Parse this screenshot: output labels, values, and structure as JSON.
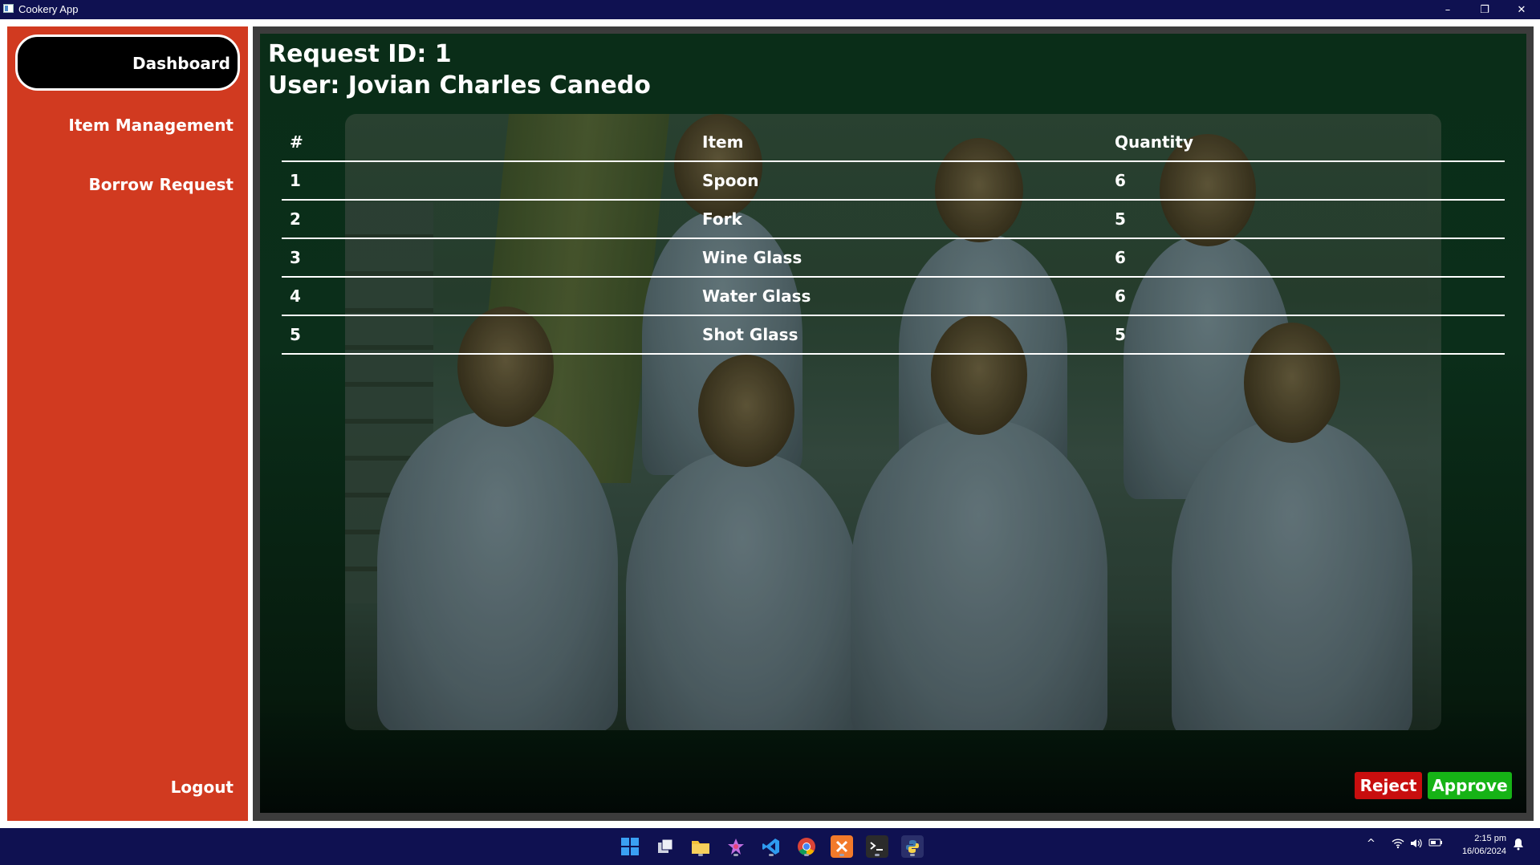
{
  "window": {
    "title": "Cookery App",
    "controls": {
      "minimize": "–",
      "restore": "❐",
      "close": "✕"
    }
  },
  "sidebar": {
    "items": [
      {
        "label": "Dashboard",
        "active": true
      },
      {
        "label": "Item Management"
      },
      {
        "label": "Borrow Request"
      }
    ],
    "logout_label": "Logout"
  },
  "request": {
    "id_label": "Request ID: 1",
    "user_label": "User: Jovian Charles Canedo"
  },
  "table": {
    "headers": [
      "#",
      "Item",
      "Quantity"
    ],
    "rows": [
      [
        "1",
        "Spoon",
        "6"
      ],
      [
        "2",
        "Fork",
        "5"
      ],
      [
        "3",
        "Wine Glass",
        "6"
      ],
      [
        "4",
        "Water Glass",
        "6"
      ],
      [
        "5",
        "Shot Glass",
        "5"
      ]
    ]
  },
  "actions": {
    "reject_label": "Reject",
    "approve_label": "Approve"
  },
  "colors": {
    "sidebar": "#d13a20",
    "reject": "#c80e0e",
    "approve": "#16b316",
    "titlebar": "#0f1151"
  },
  "taskbar": {
    "icons": [
      "windows-start-icon",
      "task-view-icon",
      "file-explorer-icon",
      "visual-studio-icon",
      "vscode-icon",
      "chrome-icon",
      "xampp-icon",
      "terminal-icon",
      "python-icon"
    ],
    "time": "2:15 pm",
    "date": "16/06/2024"
  }
}
